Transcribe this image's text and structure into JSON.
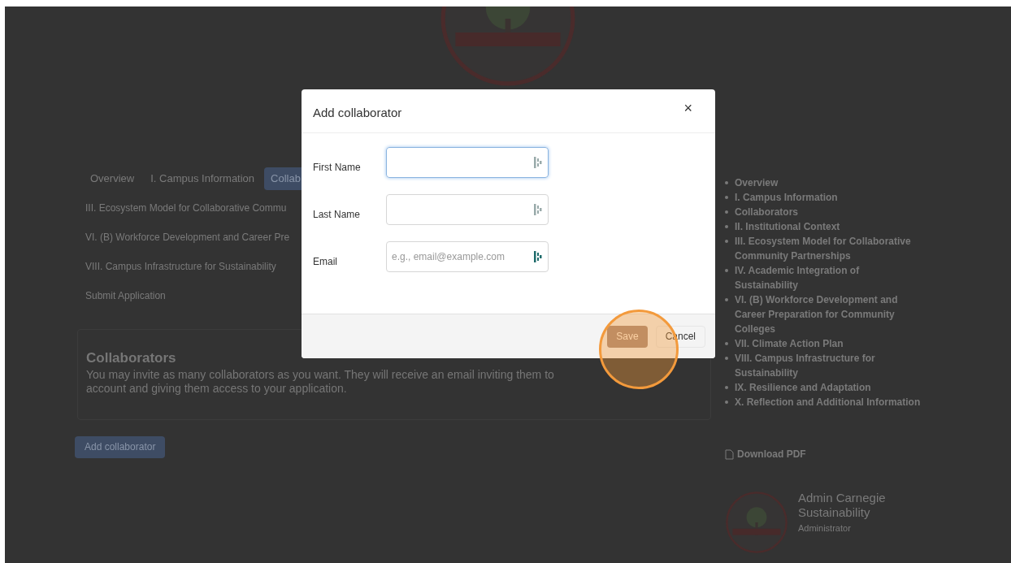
{
  "page": {
    "tabs": [
      {
        "label": "Overview",
        "selected": false
      },
      {
        "label": "I. Campus Information",
        "selected": false
      },
      {
        "label": "Collab",
        "selected": true
      }
    ],
    "section_links": [
      "III. Ecosystem Model for Collaborative Commu",
      "VI. (B) Workforce Development and Career Pre",
      "VIII. Campus Infrastructure for Sustainability",
      "Submit Application"
    ],
    "card": {
      "title": "Collaborators",
      "text": "You may invite as many collaborators as you want. They will receive an email inviting them to",
      "text_2": "account and giving them access to your application."
    },
    "add_button": "Add collaborator",
    "toc": [
      "Overview",
      "I. Campus Information",
      "Collaborators",
      "II. Institutional Context",
      "III. Ecosystem Model for Collaborative Community Partnerships",
      "IV. Academic Integration of Sustainability",
      "VI. (B) Workforce Development and Career Preparation for Community Colleges",
      "VII. Climate Action Plan",
      "VIII. Campus Infrastructure for Sustainability",
      "IX. Resilience and Adaptation",
      "X. Reflection and Additional Information"
    ],
    "download": "Download PDF",
    "user": {
      "name": "Admin Carnegie Sustainability",
      "role": "Administrator"
    }
  },
  "dialog": {
    "title": "Add collaborator",
    "close": "×",
    "fields": [
      {
        "label": "First Name",
        "focused": true
      },
      {
        "label": "Last Name",
        "focused": false
      },
      {
        "label": "Email",
        "placeholder": "e.g., email@example.com",
        "focused": false
      }
    ],
    "buttons": [
      {
        "label": "Save",
        "kind": "primary"
      },
      {
        "label": "Cancel",
        "kind": "secondary"
      }
    ]
  }
}
